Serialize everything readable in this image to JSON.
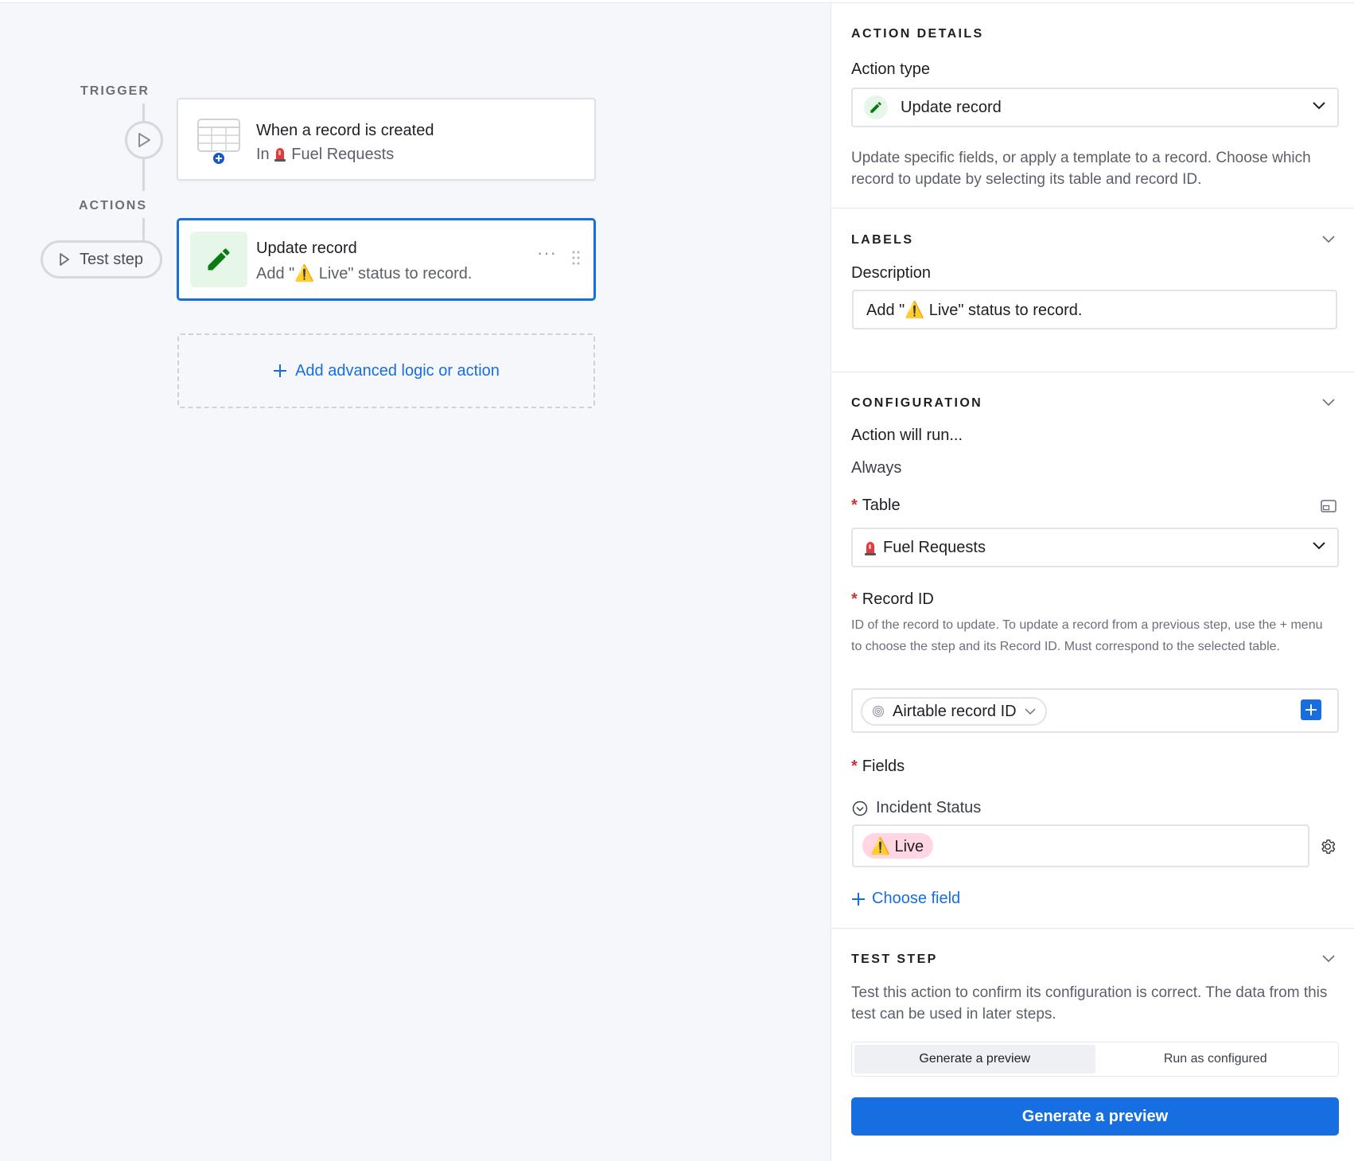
{
  "canvas": {
    "trigger_label": "TRIGGER",
    "actions_label": "ACTIONS",
    "test_step_label": "Test step",
    "trigger_card": {
      "title": "When a record is created",
      "prefix": "In",
      "table": "Fuel Requests"
    },
    "action_card": {
      "title": "Update record",
      "description": "Add \"⚠️ Live\" status to record.",
      "more": "···"
    },
    "add_logic_label": "Add advanced logic or action"
  },
  "panel": {
    "action_details": {
      "heading": "ACTION DETAILS",
      "action_type_label": "Action type",
      "action_type_value": "Update record",
      "help": "Update specific fields, or apply a template to a record. Choose which record to update by selecting its table and record ID."
    },
    "labels": {
      "heading": "LABELS",
      "description_label": "Description",
      "description_value": "Add \"⚠️ Live\" status to record."
    },
    "configuration": {
      "heading": "CONFIGURATION",
      "run_label": "Action will run...",
      "run_value": "Always",
      "table_label": "Table",
      "table_value": "Fuel Requests",
      "record_id_label": "Record ID",
      "record_id_help": "ID of the record to update. To update a record from a previous step, use the + menu to choose the step and its Record ID. Must correspond to the selected table.",
      "record_id_token": "Airtable record ID",
      "fields_label": "Fields",
      "field_name": "Incident Status",
      "field_value": "⚠️ Live",
      "choose_field": "Choose field"
    },
    "test_step": {
      "heading": "TEST STEP",
      "help": "Test this action to confirm its configuration is correct. The data from this test can be used in later steps.",
      "seg_preview": "Generate a preview",
      "seg_run": "Run as configured",
      "button": "Generate a preview"
    }
  },
  "colors": {
    "accent": "#166ee1",
    "canvas_bg": "#f6f7fa",
    "pencil_green": "#0b7a12",
    "live_chip": "#ffd6e2",
    "required": "#d42f2f"
  }
}
